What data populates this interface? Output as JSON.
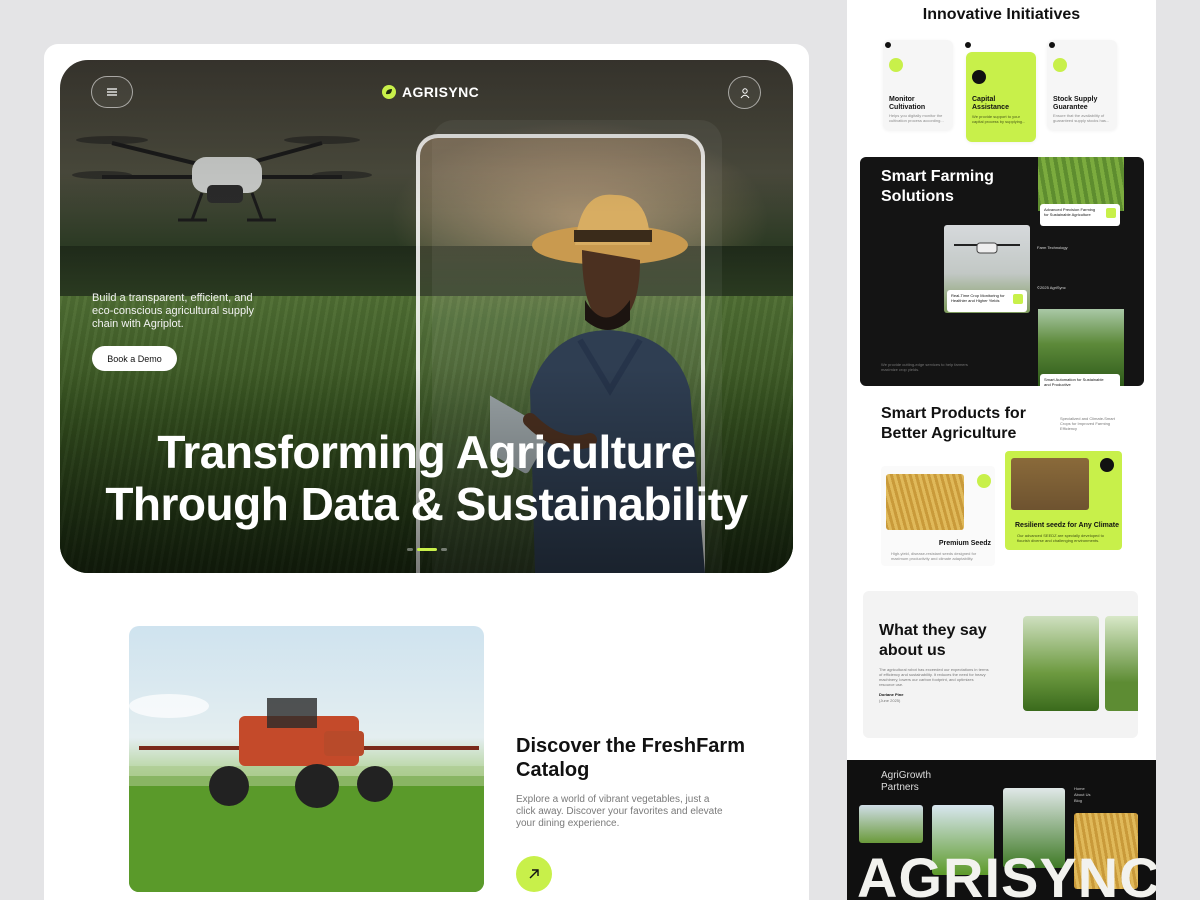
{
  "hero": {
    "brand": "AGRISYNC",
    "subtitle": "Build a transparent, efficient, and eco-conscious agricultural supply chain with Agriplot.",
    "cta": "Book a Demo",
    "title_line1": "Transforming Agriculture",
    "title_line2": "Through Data & Sustainability"
  },
  "discover": {
    "title": "Discover the FreshFarm Catalog",
    "text": "Explore a world of vibrant vegetables, just a click away. Discover your favorites and elevate your dining experience."
  },
  "initiatives": {
    "title": "Innovative Initiatives",
    "cards": [
      {
        "title": "Monitor Cultivation",
        "text": "Helps you digitally monitor the cultivation process according..."
      },
      {
        "title": "Capital Assistance",
        "text": "We provide support to your capital process by supplying..."
      },
      {
        "title": "Stock Supply Guarantee",
        "text": "Ensure that the availability of guaranteed supply stocks has..."
      }
    ]
  },
  "smart": {
    "title": "Smart Farming Solutions",
    "card1": "Advanced Precision Farming for Sustainable Agriculture",
    "card2": "Real-Time Crop Monitoring for Healthier and Higher Yields",
    "card3": "Smart Automation for Sustainable and Productive",
    "farm_tech": "Farm Technology",
    "copyright": "©2025 AgriSync",
    "footer": "We provide cutting-edge services to help farmers maximize crop yields."
  },
  "products": {
    "title": "Smart Products for Better Agriculture",
    "note": "Specialized and Climate-Smart Crops for Improved Farming Efficiency",
    "card1_title": "Premium Seedz",
    "card1_text": "High-yield, disease-resistant seeds designed for maximum productivity and climate adaptability.",
    "card2_title": "Resilient seedz for Any Climate",
    "card2_text": "Our advanced SEEDZ are specially developed to flourish diverse and challenging environments."
  },
  "review": {
    "title": "What they say about us",
    "text": "The agricultural robot has exceeded our expectations in terms of efficiency and sustainability. It reduces the need for heavy machinery, lowers our carbon footprint, and optimizes resource use.",
    "name": "Doriane Pine",
    "date": "(June 2025)"
  },
  "partners": {
    "title": "AgriGrowth Partners",
    "nav": [
      "Home",
      "About Us",
      "Blog"
    ],
    "wordmark": "AGRISYNC"
  },
  "colors": {
    "accent": "#c8f04a",
    "dark": "#141414"
  }
}
